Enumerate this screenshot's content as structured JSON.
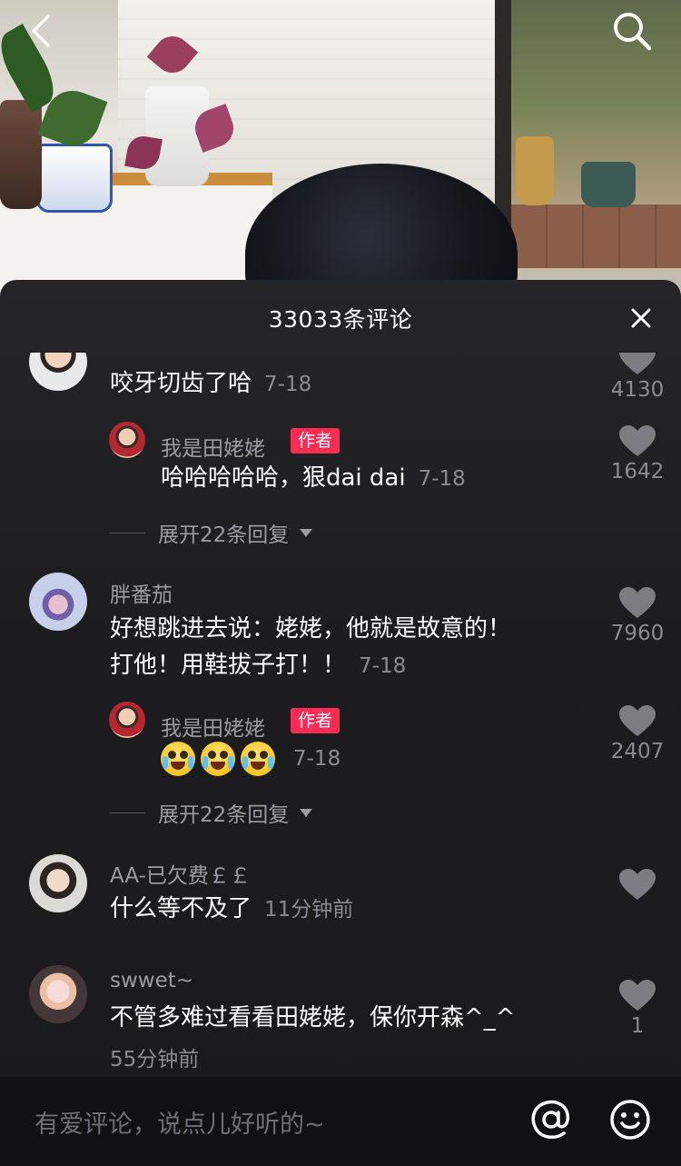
{
  "header": {
    "title": "33033条评论"
  },
  "comments": [
    {
      "text": "咬牙切齿了哈",
      "time": "7-18",
      "likes": "4130"
    },
    {
      "username": "我是田姥姥",
      "badge": "作者",
      "text": "哈哈哈哈哈，狠dai dai",
      "time": "7-18",
      "likes": "1642"
    },
    {
      "expand": "展开22条回复"
    },
    {
      "username": "胖番茄",
      "text_line1": "好想跳进去说：姥姥，他就是故意的！",
      "text_line2": "打他！用鞋拔子打！！",
      "time": "7-18",
      "likes": "7960"
    },
    {
      "username": "我是田姥姥",
      "badge": "作者",
      "time": "7-18",
      "likes": "2407"
    },
    {
      "expand": "展开22条回复"
    },
    {
      "username": "AA-已欠费￡￡",
      "text": "什么等不及了",
      "time": "11分钟前"
    },
    {
      "username": "swwet~",
      "text": "不管多难过看看田姥姥，保你开森^_^",
      "time": "55分钟前",
      "likes": "1"
    }
  ],
  "input": {
    "placeholder": "有爱评论，说点儿好听的~"
  },
  "icons": [
    "back-icon",
    "search-icon",
    "close-icon",
    "heart-icon",
    "at-icon",
    "emoji-icon"
  ],
  "colors": {
    "badge": "#fe2c55",
    "sheet_bg": "#1d1d20",
    "muted_text": "#8a8a90"
  }
}
